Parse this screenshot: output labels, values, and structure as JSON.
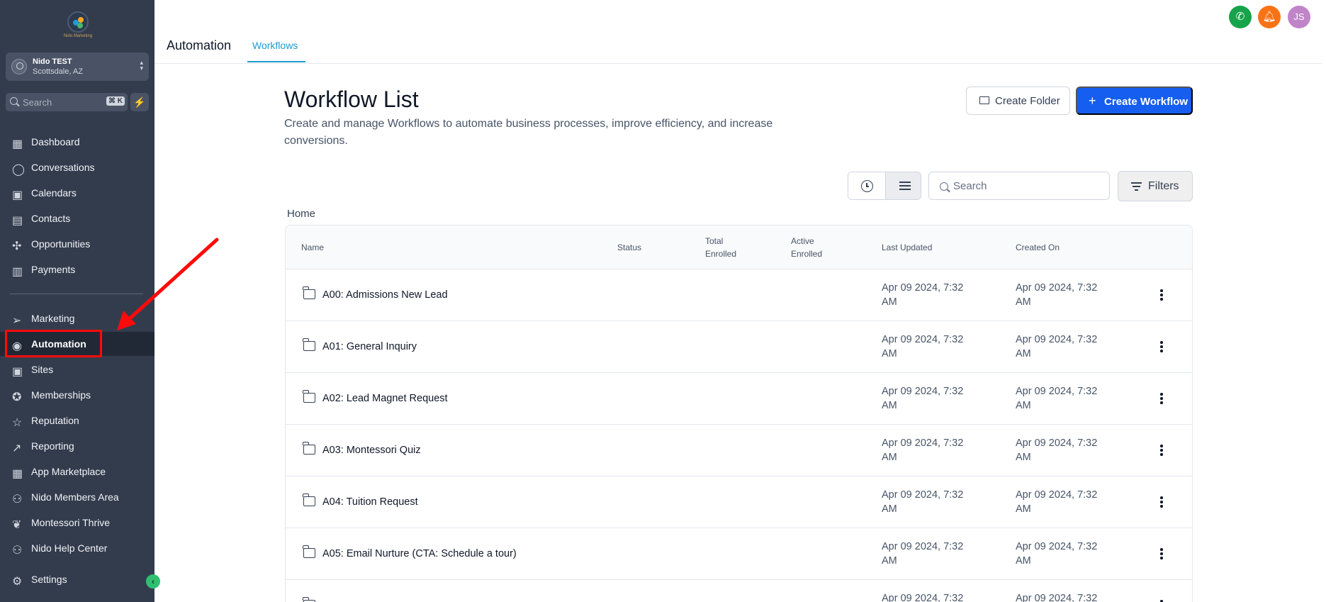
{
  "brand": {
    "logo_text": "Nido Marketing"
  },
  "account": {
    "name": "Nido TEST",
    "location": "Scottsdale, AZ"
  },
  "sidebar_search": {
    "placeholder": "Search",
    "shortcut": "⌘ K"
  },
  "nav": [
    {
      "label": "Dashboard",
      "icon": "dashboard-icon"
    },
    {
      "label": "Conversations",
      "icon": "chat-icon"
    },
    {
      "label": "Calendars",
      "icon": "calendar-icon"
    },
    {
      "label": "Contacts",
      "icon": "contacts-icon"
    },
    {
      "label": "Opportunities",
      "icon": "opportunities-icon"
    },
    {
      "label": "Payments",
      "icon": "payments-icon"
    },
    {
      "label": "Marketing",
      "icon": "send-icon"
    },
    {
      "label": "Automation",
      "icon": "automation-icon",
      "active": true
    },
    {
      "label": "Sites",
      "icon": "sites-icon"
    },
    {
      "label": "Memberships",
      "icon": "membership-icon"
    },
    {
      "label": "Reputation",
      "icon": "star-icon"
    },
    {
      "label": "Reporting",
      "icon": "chart-icon"
    },
    {
      "label": "App Marketplace",
      "icon": "apps-icon"
    },
    {
      "label": "Nido Members Area",
      "icon": "users-icon"
    },
    {
      "label": "Montessori Thrive",
      "icon": "leaf-icon"
    },
    {
      "label": "Nido Help Center",
      "icon": "help-users-icon"
    },
    {
      "label": "Settings",
      "icon": "gear-icon"
    }
  ],
  "header": {
    "title": "Automation",
    "tab": "Workflows",
    "user_initials": "JS"
  },
  "page": {
    "title": "Workflow List",
    "description": "Create and manage Workflows to automate business processes, improve efficiency, and increase conversions.",
    "create_folder": "Create Folder",
    "create_workflow": "Create Workflow",
    "search_placeholder": "Search",
    "filters": "Filters",
    "breadcrumb": "Home"
  },
  "table": {
    "headers": {
      "name": "Name",
      "status": "Status",
      "total_1": "Total",
      "total_2": "Enrolled",
      "active_1": "Active",
      "active_2": "Enrolled",
      "updated": "Last Updated",
      "created": "Created On"
    },
    "rows": [
      {
        "name": "A00: Admissions New Lead",
        "updated_1": "Apr 09 2024, 7:32",
        "updated_2": "AM",
        "created_1": "Apr 09 2024, 7:32",
        "created_2": "AM"
      },
      {
        "name": "A01: General Inquiry",
        "updated_1": "Apr 09 2024, 7:32",
        "updated_2": "AM",
        "created_1": "Apr 09 2024, 7:32",
        "created_2": "AM"
      },
      {
        "name": "A02: Lead Magnet Request",
        "updated_1": "Apr 09 2024, 7:32",
        "updated_2": "AM",
        "created_1": "Apr 09 2024, 7:32",
        "created_2": "AM"
      },
      {
        "name": "A03: Montessori Quiz",
        "updated_1": "Apr 09 2024, 7:32",
        "updated_2": "AM",
        "created_1": "Apr 09 2024, 7:32",
        "created_2": "AM"
      },
      {
        "name": "A04: Tuition Request",
        "updated_1": "Apr 09 2024, 7:32",
        "updated_2": "AM",
        "created_1": "Apr 09 2024, 7:32",
        "created_2": "AM"
      },
      {
        "name": "A05: Email Nurture (CTA: Schedule a tour)",
        "updated_1": "Apr 09 2024, 7:32",
        "updated_2": "AM",
        "created_1": "Apr 09 2024, 7:32",
        "created_2": "AM"
      },
      {
        "name": "",
        "updated_1": "Apr 09 2024, 7:32",
        "updated_2": "",
        "created_1": "Apr 09 2024, 7:32",
        "created_2": ""
      }
    ]
  },
  "colors": {
    "sidebar": "#333c4d",
    "accent": "#155eef",
    "tab": "#1d9bd1",
    "annotation": "#ff0a0a"
  }
}
